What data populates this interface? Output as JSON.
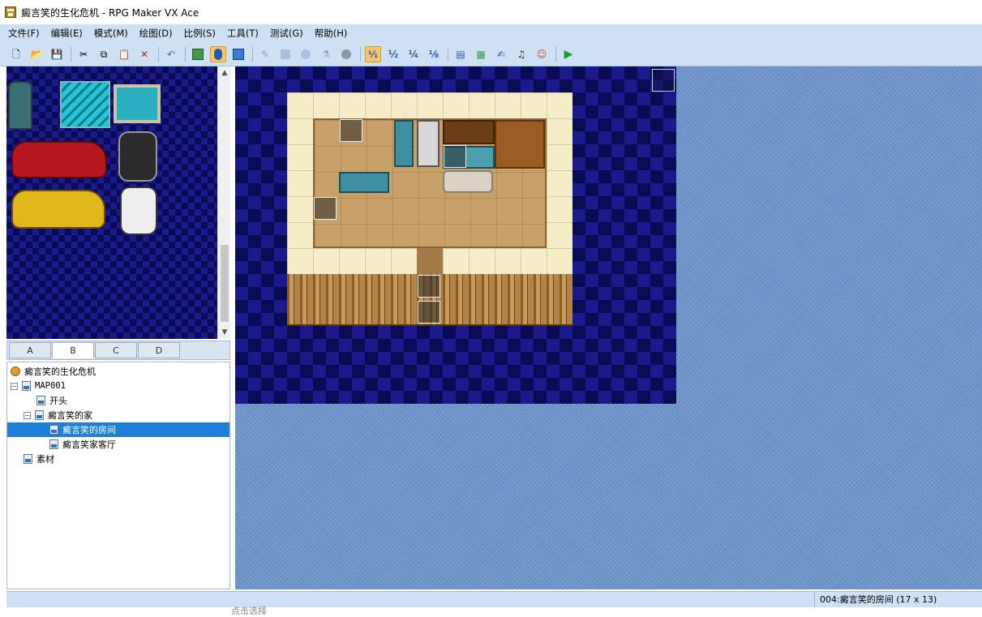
{
  "window": {
    "title": "癜言笑的生化危机 - RPG Maker VX Ace"
  },
  "menu": [
    "文件(F)",
    "编辑(E)",
    "模式(M)",
    "绘图(D)",
    "比例(S)",
    "工具(T)",
    "测试(G)",
    "帮助(H)"
  ],
  "toolbar": {
    "groups": [
      [
        "new-project-icon",
        "open-project-icon",
        "save-project-icon"
      ],
      [
        "cut-icon",
        "copy-icon",
        "paste-icon",
        "delete-icon"
      ],
      [
        "undo-icon"
      ],
      [
        "map-layer-icon",
        "event-layer-icon",
        "region-layer-icon"
      ],
      [
        "pencil-icon",
        "rectangle-icon",
        "ellipse-icon",
        "flood-fill-icon",
        "shadow-pen-icon"
      ],
      [
        "zoom-1-1-icon",
        "zoom-1-2-icon",
        "zoom-1-4-icon",
        "zoom-1-8-icon"
      ],
      [
        "database-icon",
        "resource-manager-icon",
        "script-editor-icon",
        "sound-test-icon",
        "character-generator-icon"
      ],
      [
        "playtest-icon"
      ]
    ],
    "zoom_labels": [
      "¹⁄₁",
      "½",
      "¼",
      "⅛"
    ],
    "active": [
      "event-layer-icon",
      "zoom-1-1-icon"
    ]
  },
  "tileset_tabs": [
    "A",
    "B",
    "C",
    "D"
  ],
  "selected_tab": "B",
  "map_tree": [
    {
      "label": "癜言笑的生化危机",
      "level": 0,
      "kind": "project",
      "expander": ""
    },
    {
      "label": "MAP001",
      "level": 0,
      "kind": "map",
      "expander": "⊟"
    },
    {
      "label": "开头",
      "level": 1,
      "kind": "map",
      "expander": ""
    },
    {
      "label": "癜言笑的家",
      "level": 1,
      "kind": "map",
      "expander": "⊟"
    },
    {
      "label": "癜言笑的房间",
      "level": 2,
      "kind": "map",
      "expander": "",
      "selected": true
    },
    {
      "label": "癜言笑家客厅",
      "level": 2,
      "kind": "map",
      "expander": ""
    },
    {
      "label": "素材",
      "level": 0,
      "kind": "map",
      "expander": ""
    }
  ],
  "status": {
    "map_info": "004:癜言笑的房间 (17 x 13)"
  },
  "bottom_fragment": "点击选择"
}
